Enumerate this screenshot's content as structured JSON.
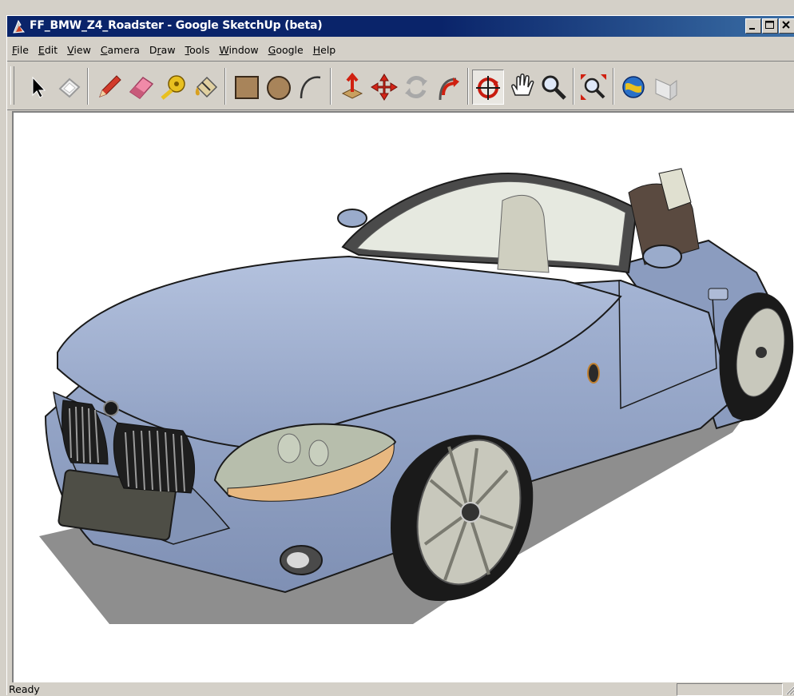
{
  "window": {
    "title": "FF_BMW_Z4_Roadster - Google SketchUp (beta)",
    "app_icon": "sketchup-icon",
    "controls": [
      "minimize-icon",
      "maximize-icon",
      "close-icon"
    ]
  },
  "menu": [
    {
      "label": "File",
      "mnemonic": "F",
      "rest": "ile"
    },
    {
      "label": "Edit",
      "mnemonic": "E",
      "rest": "dit"
    },
    {
      "label": "View",
      "mnemonic": "V",
      "rest": "iew"
    },
    {
      "label": "Camera",
      "mnemonic": "C",
      "rest": "amera"
    },
    {
      "label": "Draw",
      "pre": "D",
      "mnemonic": "r",
      "rest": "aw"
    },
    {
      "label": "Tools",
      "mnemonic": "T",
      "rest": "ools"
    },
    {
      "label": "Window",
      "mnemonic": "W",
      "rest": "indow"
    },
    {
      "label": "Google",
      "mnemonic": "G",
      "rest": "oogle"
    },
    {
      "label": "Help",
      "mnemonic": "H",
      "rest": "elp"
    }
  ],
  "toolbar": {
    "tools": [
      "select-tool-icon",
      "eraser-tool-icon",
      "pencil-tool-icon",
      "eraser-pink-icon",
      "tape-measure-icon",
      "paint-bucket-icon",
      "rectangle-tool-icon",
      "circle-tool-icon",
      "arc-tool-icon",
      "push-pull-icon",
      "move-tool-icon",
      "rotate-tool-icon",
      "follow-me-icon",
      "orbit-tool-icon",
      "pan-tool-icon",
      "zoom-tool-icon",
      "zoom-extents-icon",
      "get-models-icon",
      "share-model-icon"
    ],
    "active_tool": "orbit-tool-icon"
  },
  "viewport": {
    "model": "BMW Z4 roadster",
    "body_color": "#9fb0d0"
  },
  "status": {
    "text": "Ready",
    "measurement_value": ""
  }
}
